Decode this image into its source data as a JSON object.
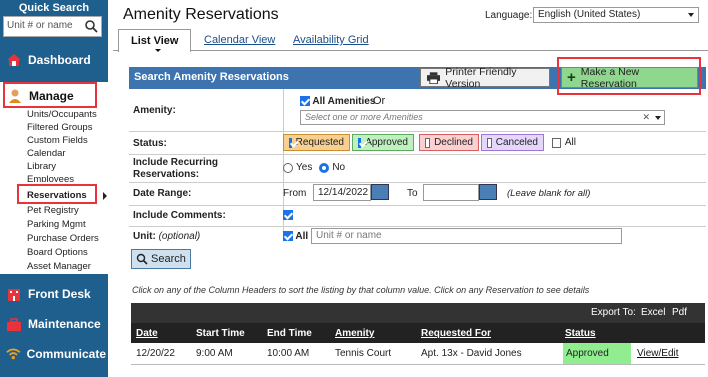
{
  "sidebar": {
    "quick_search_title": "Quick Search",
    "search_placeholder": "Unit # or name",
    "nav": {
      "dashboard": "Dashboard",
      "manage": "Manage",
      "front_desk": "Front Desk",
      "maintenance": "Maintenance",
      "communicate": "Communicate"
    },
    "manage_items": [
      "Units/Occupants",
      "Filtered Groups",
      "Custom Fields",
      "Calendar",
      "Library",
      "Employees",
      "Reservations",
      "Pet Registry",
      "Parking Mgmt",
      "Purchase Orders",
      "Board Options",
      "Asset Manager"
    ]
  },
  "header": {
    "title": "Amenity Reservations",
    "language_label": "Language:",
    "language_value": "English (United States)"
  },
  "tabs": {
    "list_view": "List View",
    "calendar_view": "Calendar View",
    "availability_grid": "Availability Grid"
  },
  "search_panel": {
    "title": "Search Amenity Reservations",
    "printer_button": "Printer Friendly Version",
    "new_reservation_button": "Make a New Reservation",
    "amenity_label": "Amenity:",
    "all_amenities": "All Amenities",
    "or_text": "Or",
    "amenity_placeholder": "Select one or more Amenities",
    "status_label": "Status:",
    "statuses": {
      "requested": "Requested",
      "approved": "Approved",
      "declined": "Declined",
      "canceled": "Canceled",
      "all": "All"
    },
    "recurring_label": "Include Recurring Reservations:",
    "recurring_yes": "Yes",
    "recurring_no": "No",
    "date_range_label": "Date Range:",
    "from_label": "From",
    "from_value": "12/14/2022",
    "to_label": "To",
    "blank_note": "(Leave blank for all)",
    "comments_label": "Include Comments:",
    "unit_label": "Unit:",
    "unit_optional": "(optional)",
    "unit_all": "All",
    "unit_placeholder": "Unit # or name",
    "search_button": "Search"
  },
  "results": {
    "hint": "Click on any of the Column Headers to sort the listing by that column value. Click on any Reservation to see details",
    "export_to": "Export To:",
    "excel": "Excel",
    "pdf": "Pdf",
    "columns": {
      "date": "Date",
      "start_time": "Start Time",
      "end_time": "End Time",
      "amenity": "Amenity",
      "requested_for": "Requested For",
      "status": "Status"
    },
    "rows": [
      {
        "date": "12/20/22",
        "start_time": "9:00 AM",
        "end_time": "10:00 AM",
        "amenity": "Tennis Court",
        "requested_for": "Apt. 13x - David Jones",
        "status": "Approved",
        "action": "View/Edit"
      }
    ]
  },
  "colors": {
    "sidebar": "#1f5f8d",
    "panel_header": "#3d74b0",
    "new_button": "#8fd68f",
    "highlight": "#e8333d",
    "approved": "#90ee90"
  }
}
